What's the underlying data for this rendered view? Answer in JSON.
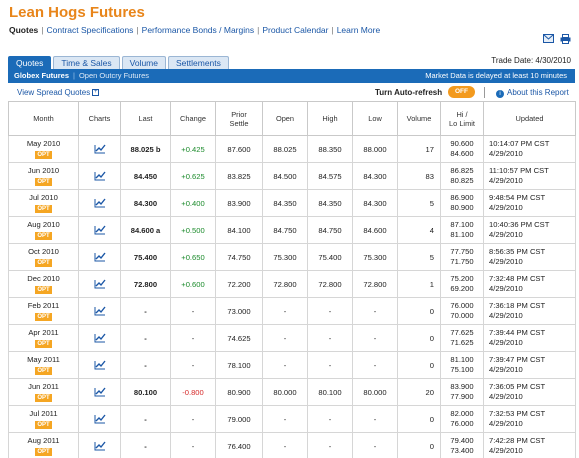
{
  "page": {
    "title": "Lean Hogs Futures",
    "nav": {
      "current": "Quotes",
      "links": [
        "Contract Specifications",
        "Performance Bonds / Margins",
        "Product Calendar",
        "Learn More"
      ]
    },
    "trade_date": "Trade Date: 4/30/2010"
  },
  "tabs": [
    {
      "label": "Quotes",
      "active": true
    },
    {
      "label": "Time & Sales",
      "active": false
    },
    {
      "label": "Volume",
      "active": false
    },
    {
      "label": "Settlements",
      "active": false
    }
  ],
  "bar": {
    "globex": "Globex Futures",
    "outcry": "Open Outcry Futures",
    "delay": "Market Data is delayed at least 10 minutes"
  },
  "toolbar": {
    "spread": "View Spread Quotes",
    "refresh_label": "Turn Auto-refresh",
    "toggle": "OFF",
    "about": "About this Report"
  },
  "headers": {
    "month": "Month",
    "charts": "Charts",
    "last": "Last",
    "change": "Change",
    "prior1": "Prior",
    "prior2": "Settle",
    "open": "Open",
    "high": "High",
    "low": "Low",
    "volume": "Volume",
    "hilo1": "Hi /",
    "hilo2": "Lo Limit",
    "updated": "Updated"
  },
  "opt_label": "OPT",
  "rows": [
    {
      "month": "May 2010",
      "last": "88.025 b",
      "change": "+0.425",
      "prior": "87.600",
      "open": "88.025",
      "high": "88.350",
      "low": "88.000",
      "volume": "17",
      "hi": "90.600",
      "lo": "84.600",
      "time": "10:14:07 PM CST",
      "date": "4/29/2010"
    },
    {
      "month": "Jun 2010",
      "last": "84.450",
      "change": "+0.625",
      "prior": "83.825",
      "open": "84.500",
      "high": "84.575",
      "low": "84.300",
      "volume": "83",
      "hi": "86.825",
      "lo": "80.825",
      "time": "11:10:57 PM CST",
      "date": "4/29/2010"
    },
    {
      "month": "Jul 2010",
      "last": "84.300",
      "change": "+0.400",
      "prior": "83.900",
      "open": "84.350",
      "high": "84.350",
      "low": "84.300",
      "volume": "5",
      "hi": "86.900",
      "lo": "80.900",
      "time": "9:48:54 PM CST",
      "date": "4/29/2010"
    },
    {
      "month": "Aug 2010",
      "last": "84.600 a",
      "change": "+0.500",
      "prior": "84.100",
      "open": "84.750",
      "high": "84.750",
      "low": "84.600",
      "volume": "4",
      "hi": "87.100",
      "lo": "81.100",
      "time": "10:40:36 PM CST",
      "date": "4/29/2010"
    },
    {
      "month": "Oct 2010",
      "last": "75.400",
      "change": "+0.650",
      "prior": "74.750",
      "open": "75.300",
      "high": "75.400",
      "low": "75.300",
      "volume": "5",
      "hi": "77.750",
      "lo": "71.750",
      "time": "8:56:35 PM CST",
      "date": "4/29/2010"
    },
    {
      "month": "Dec 2010",
      "last": "72.800",
      "change": "+0.600",
      "prior": "72.200",
      "open": "72.800",
      "high": "72.800",
      "low": "72.800",
      "volume": "1",
      "hi": "75.200",
      "lo": "69.200",
      "time": "7:32:48 PM CST",
      "date": "4/29/2010"
    },
    {
      "month": "Feb 2011",
      "last": "-",
      "change": "-",
      "prior": "73.000",
      "open": "-",
      "high": "-",
      "low": "-",
      "volume": "0",
      "hi": "76.000",
      "lo": "70.000",
      "time": "7:36:18 PM CST",
      "date": "4/29/2010"
    },
    {
      "month": "Apr 2011",
      "last": "-",
      "change": "-",
      "prior": "74.625",
      "open": "-",
      "high": "-",
      "low": "-",
      "volume": "0",
      "hi": "77.625",
      "lo": "71.625",
      "time": "7:39:44 PM CST",
      "date": "4/29/2010"
    },
    {
      "month": "May 2011",
      "last": "-",
      "change": "-",
      "prior": "78.100",
      "open": "-",
      "high": "-",
      "low": "-",
      "volume": "0",
      "hi": "81.100",
      "lo": "75.100",
      "time": "7:39:47 PM CST",
      "date": "4/29/2010"
    },
    {
      "month": "Jun 2011",
      "last": "80.100",
      "change": "-0.800",
      "prior": "80.900",
      "open": "80.000",
      "high": "80.100",
      "low": "80.000",
      "volume": "20",
      "hi": "83.900",
      "lo": "77.900",
      "time": "7:36:05 PM CST",
      "date": "4/29/2010"
    },
    {
      "month": "Jul 2011",
      "last": "-",
      "change": "-",
      "prior": "79.000",
      "open": "-",
      "high": "-",
      "low": "-",
      "volume": "0",
      "hi": "82.000",
      "lo": "76.000",
      "time": "7:32:53 PM CST",
      "date": "4/29/2010"
    },
    {
      "month": "Aug 2011",
      "last": "-",
      "change": "-",
      "prior": "76.400",
      "open": "-",
      "high": "-",
      "low": "-",
      "volume": "0",
      "hi": "79.400",
      "lo": "73.400",
      "time": "7:42:28 PM CST",
      "date": "4/29/2010"
    }
  ],
  "colors": {
    "accent": "#e8851a",
    "blue": "#1b6bb8",
    "up": "#1c8b2c",
    "down": "#d62b2b",
    "opt": "#f5a623"
  },
  "icons": [
    "email-icon",
    "print-icon",
    "chart-icon",
    "info-icon",
    "expand-icon"
  ]
}
